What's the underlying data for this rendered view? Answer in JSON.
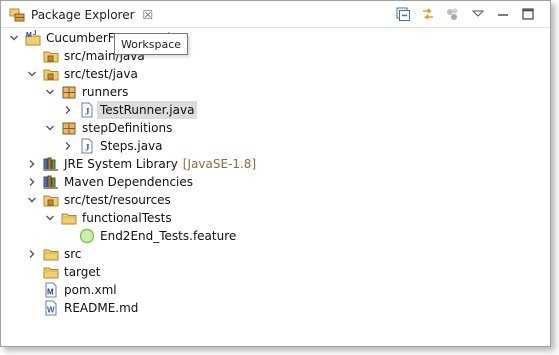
{
  "view": {
    "title": "Package Explorer",
    "close_glyph": "☒"
  },
  "toolbar": {
    "items": [
      "collapse-all-icon",
      "link-with-editor-icon",
      "view-menu-dots-icon",
      "view-menu-triangle-icon",
      "minimize-icon",
      "maximize-icon"
    ]
  },
  "tooltip": {
    "text": "Workspace"
  },
  "tree": {
    "project": {
      "label": "CucumberFramework",
      "state": "expanded"
    },
    "items": [
      {
        "label": "src/main/java",
        "icon": "source-folder-icon"
      },
      {
        "label": "src/test/java",
        "icon": "source-folder-icon",
        "state": "expanded"
      },
      {
        "label": "runners",
        "icon": "package-icon",
        "state": "expanded"
      },
      {
        "label": "TestRunner.java",
        "icon": "java-file-icon",
        "state": "collapsed",
        "selected": true
      },
      {
        "label": "stepDefinitions",
        "icon": "package-icon",
        "state": "expanded"
      },
      {
        "label": "Steps.java",
        "icon": "java-file-icon",
        "state": "collapsed"
      },
      {
        "label": "JRE System Library",
        "decoration": "[JavaSE-1.8]",
        "icon": "library-icon",
        "state": "collapsed"
      },
      {
        "label": "Maven Dependencies",
        "icon": "library-icon",
        "state": "collapsed"
      },
      {
        "label": "src/test/resources",
        "icon": "source-folder-icon",
        "state": "expanded"
      },
      {
        "label": "functionalTests",
        "icon": "folder-icon",
        "state": "expanded"
      },
      {
        "label": "End2End_Tests.feature",
        "icon": "feature-file-icon"
      },
      {
        "label": "src",
        "icon": "folder-icon",
        "state": "collapsed"
      },
      {
        "label": "target",
        "icon": "folder-icon"
      },
      {
        "label": "pom.xml",
        "icon": "maven-file-icon"
      },
      {
        "label": "README.md",
        "icon": "text-file-icon"
      }
    ]
  },
  "colors": {
    "selection": "#dcdcdc",
    "decoration": "#8c6d3a",
    "folder": "#e8b64c",
    "package": "#b3742a",
    "java": "#1b5cb8",
    "feature": "#7ac943"
  }
}
